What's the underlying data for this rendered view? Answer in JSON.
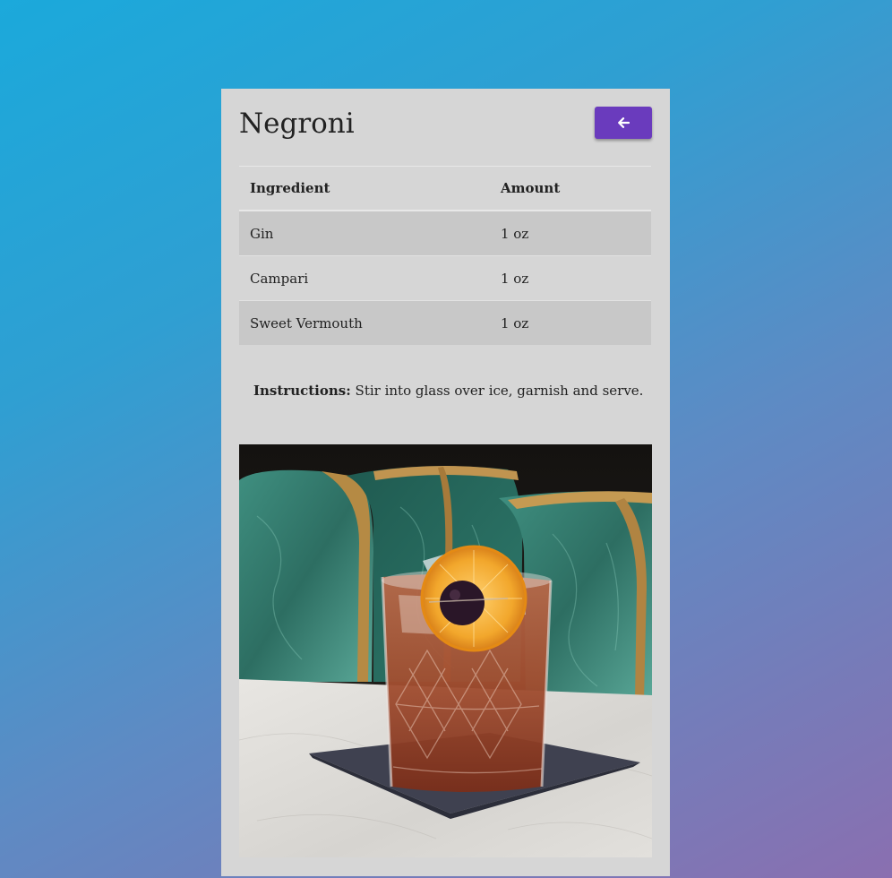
{
  "recipe": {
    "title": "Negroni",
    "back_button_icon": "arrow-left-icon",
    "table": {
      "headers": [
        "Ingredient",
        "Amount"
      ],
      "rows": [
        {
          "ingredient": "Gin",
          "amount": "1 oz"
        },
        {
          "ingredient": "Campari",
          "amount": "1 oz"
        },
        {
          "ingredient": "Sweet Vermouth",
          "amount": "1 oz"
        }
      ]
    },
    "instructions_label": "Instructions:",
    "instructions_text": "Stir into glass over ice, garnish and serve."
  },
  "colors": {
    "accent": "#6a3bbd",
    "card_background": "#d6d6d6"
  }
}
